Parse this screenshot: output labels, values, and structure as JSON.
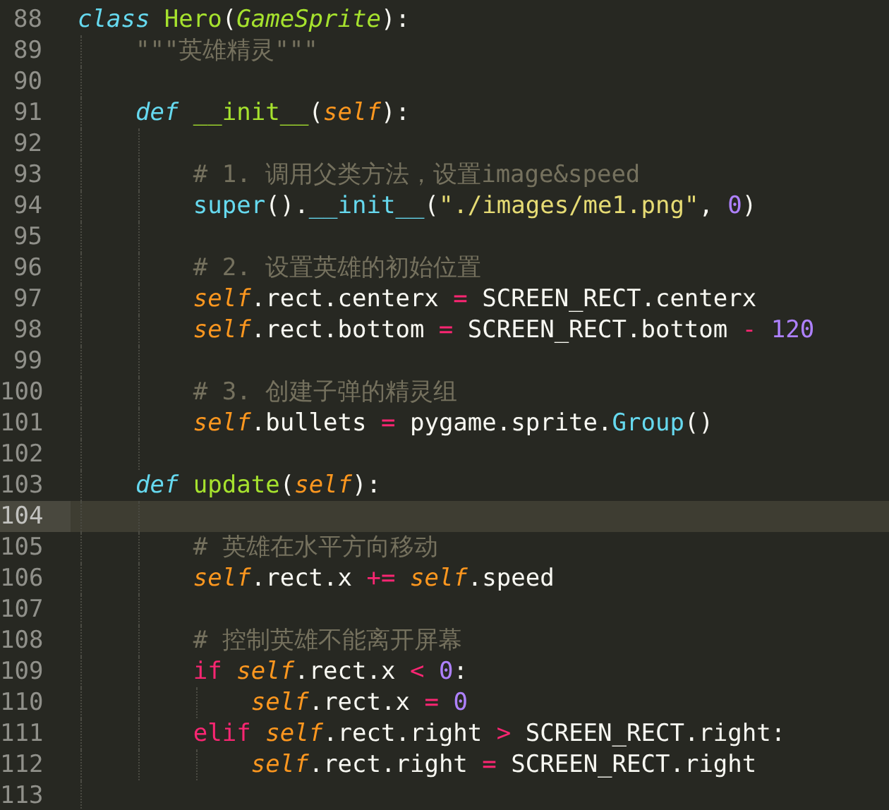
{
  "editor": {
    "lines": [
      {
        "number": "88",
        "current": false,
        "tokens": [
          {
            "kind": "keyword",
            "text": "class"
          },
          {
            "kind": "class",
            "text": " Hero"
          },
          {
            "kind": "plain",
            "text": "("
          },
          {
            "kind": "inherit",
            "text": "GameSprite"
          },
          {
            "kind": "plain",
            "text": "):"
          }
        ],
        "children": [
          {
            "number": "89",
            "current": false,
            "tokens": [
              {
                "kind": "comment",
                "text": "\"\"\"英雄精灵\"\"\""
              }
            ]
          },
          {
            "number": "90",
            "current": false
          },
          {
            "number": "91",
            "current": false,
            "tokens": [
              {
                "kind": "keyword",
                "text": "def"
              },
              {
                "kind": "function",
                "text": " __init__"
              },
              {
                "kind": "plain",
                "text": "("
              },
              {
                "kind": "param",
                "text": "self"
              },
              {
                "kind": "plain",
                "text": "):"
              }
            ],
            "children": [
              {
                "number": "92",
                "current": false
              },
              {
                "number": "93",
                "current": false,
                "tokens": [
                  {
                    "kind": "comment",
                    "text": "# 1. 调用父类方法，设置image&speed"
                  }
                ]
              },
              {
                "number": "94",
                "current": false,
                "tokens": [
                  {
                    "kind": "builtin",
                    "text": "super"
                  },
                  {
                    "kind": "plain",
                    "text": "()."
                  },
                  {
                    "kind": "builtin",
                    "text": "__init__"
                  },
                  {
                    "kind": "plain",
                    "text": "("
                  },
                  {
                    "kind": "string",
                    "text": "\"./images/me1.png\""
                  },
                  {
                    "kind": "plain",
                    "text": ", "
                  },
                  {
                    "kind": "number",
                    "text": "0"
                  },
                  {
                    "kind": "plain",
                    "text": ")"
                  }
                ]
              },
              {
                "number": "95",
                "current": false
              },
              {
                "number": "96",
                "current": false,
                "tokens": [
                  {
                    "kind": "comment",
                    "text": "# 2. 设置英雄的初始位置"
                  }
                ]
              },
              {
                "number": "97",
                "current": false,
                "tokens": [
                  {
                    "kind": "param",
                    "text": "self"
                  },
                  {
                    "kind": "plain",
                    "text": ".rect.centerx "
                  },
                  {
                    "kind": "operator",
                    "text": "="
                  },
                  {
                    "kind": "plain",
                    "text": " SCREEN_RECT.centerx"
                  }
                ]
              },
              {
                "number": "98",
                "current": false,
                "tokens": [
                  {
                    "kind": "param",
                    "text": "self"
                  },
                  {
                    "kind": "plain",
                    "text": ".rect.bottom "
                  },
                  {
                    "kind": "operator",
                    "text": "="
                  },
                  {
                    "kind": "plain",
                    "text": " SCREEN_RECT.bottom "
                  },
                  {
                    "kind": "operator",
                    "text": "-"
                  },
                  {
                    "kind": "number",
                    "text": " 120"
                  }
                ]
              },
              {
                "number": "99",
                "current": false
              },
              {
                "number": "100",
                "current": false,
                "tokens": [
                  {
                    "kind": "comment",
                    "text": "# 3. 创建子弹的精灵组"
                  }
                ]
              },
              {
                "number": "101",
                "current": false,
                "tokens": [
                  {
                    "kind": "param",
                    "text": "self"
                  },
                  {
                    "kind": "plain",
                    "text": ".bullets "
                  },
                  {
                    "kind": "operator",
                    "text": "="
                  },
                  {
                    "kind": "plain",
                    "text": " pygame.sprite."
                  },
                  {
                    "kind": "builtin",
                    "text": "Group"
                  },
                  {
                    "kind": "plain",
                    "text": "()"
                  }
                ]
              },
              {
                "number": "102",
                "current": false
              }
            ]
          },
          {
            "number": "103",
            "current": false,
            "tokens": [
              {
                "kind": "keyword",
                "text": "def"
              },
              {
                "kind": "function",
                "text": " update"
              },
              {
                "kind": "plain",
                "text": "("
              },
              {
                "kind": "param",
                "text": "self"
              },
              {
                "kind": "plain",
                "text": "):"
              }
            ],
            "children": [
              {
                "number": "104",
                "current": true
              },
              {
                "number": "105",
                "current": false,
                "tokens": [
                  {
                    "kind": "comment",
                    "text": "# 英雄在水平方向移动"
                  }
                ]
              },
              {
                "number": "106",
                "current": false,
                "tokens": [
                  {
                    "kind": "param",
                    "text": "self"
                  },
                  {
                    "kind": "plain",
                    "text": ".rect.x "
                  },
                  {
                    "kind": "operator",
                    "text": "+="
                  },
                  {
                    "kind": "param",
                    "text": " self"
                  },
                  {
                    "kind": "plain",
                    "text": ".speed"
                  }
                ]
              },
              {
                "number": "107",
                "current": false
              },
              {
                "number": "108",
                "current": false,
                "tokens": [
                  {
                    "kind": "comment",
                    "text": "# 控制英雄不能离开屏幕"
                  }
                ]
              },
              {
                "number": "109",
                "current": false,
                "tokens": [
                  {
                    "kind": "operator",
                    "text": "if"
                  },
                  {
                    "kind": "param",
                    "text": " self"
                  },
                  {
                    "kind": "plain",
                    "text": ".rect.x "
                  },
                  {
                    "kind": "operator",
                    "text": "<"
                  },
                  {
                    "kind": "number",
                    "text": " 0"
                  },
                  {
                    "kind": "plain",
                    "text": ":"
                  }
                ],
                "children": [
                  {
                    "number": "110",
                    "current": false,
                    "tokens": [
                      {
                        "kind": "param",
                        "text": "self"
                      },
                      {
                        "kind": "plain",
                        "text": ".rect.x "
                      },
                      {
                        "kind": "operator",
                        "text": "="
                      },
                      {
                        "kind": "number",
                        "text": " 0"
                      }
                    ]
                  }
                ]
              },
              {
                "number": "111",
                "current": false,
                "tokens": [
                  {
                    "kind": "operator",
                    "text": "elif"
                  },
                  {
                    "kind": "param",
                    "text": " self"
                  },
                  {
                    "kind": "plain",
                    "text": ".rect.right "
                  },
                  {
                    "kind": "operator",
                    "text": ">"
                  },
                  {
                    "kind": "plain",
                    "text": " SCREEN_RECT.right:"
                  }
                ],
                "children": [
                  {
                    "number": "112",
                    "current": false,
                    "tokens": [
                      {
                        "kind": "param",
                        "text": "self"
                      },
                      {
                        "kind": "plain",
                        "text": ".rect.right "
                      },
                      {
                        "kind": "operator",
                        "text": "="
                      },
                      {
                        "kind": "plain",
                        "text": " SCREEN_RECT.right"
                      }
                    ]
                  }
                ]
              }
            ]
          },
          {
            "number": "113",
            "current": false
          }
        ]
      }
    ]
  }
}
